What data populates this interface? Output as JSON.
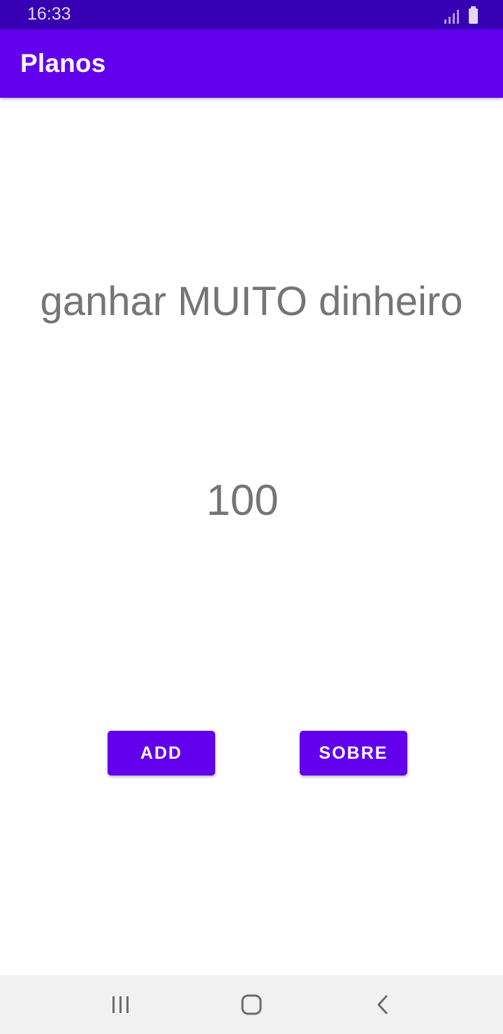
{
  "status_bar": {
    "time": "16:33",
    "icons": [
      "signal-icon",
      "battery-icon"
    ],
    "background": "#3700b3"
  },
  "app_bar": {
    "title": "Planos",
    "background": "#6200ee"
  },
  "main": {
    "plan_text": "ganhar MUITO dinheiro",
    "counter": "100",
    "text_color": "#757575"
  },
  "buttons": {
    "add_label": "ADD",
    "sobre_label": "SOBRE",
    "color": "#6200ee"
  },
  "nav_bar": {
    "icons": [
      "recents-icon",
      "home-icon",
      "back-icon"
    ]
  }
}
